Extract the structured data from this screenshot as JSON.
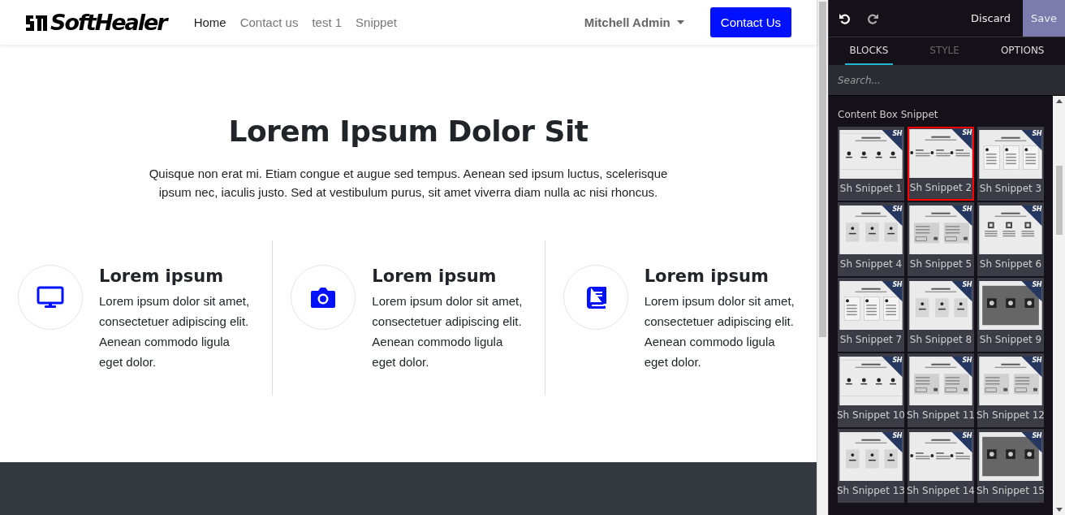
{
  "navbar": {
    "logo": "SoftHealer",
    "links": [
      {
        "label": "Home",
        "selected": true
      },
      {
        "label": "Contact us",
        "selected": false
      },
      {
        "label": "test 1",
        "selected": false
      },
      {
        "label": "Snippet",
        "selected": false
      }
    ],
    "user": "Mitchell Admin",
    "cta": "Contact Us"
  },
  "hero": {
    "title": "Lorem Ipsum Dolor Sit",
    "text": "Quisque non erat mi. Etiam congue et augue sed tempus. Aenean sed ipsum luctus, scelerisque ipsum nec, iaculis justo. Sed at vestibulum purus, sit amet viverra diam nulla ac nisi rhoncus."
  },
  "features": [
    {
      "kind": "monitor",
      "title": "Lorem ipsum",
      "text": "Lorem ipsum dolor sit amet, consectetuer adipiscing elit. Aenean commodo ligula eget dolor."
    },
    {
      "kind": "camera",
      "title": "Lorem ipsum",
      "text": "Lorem ipsum dolor sit amet, consectetuer adipiscing elit. Aenean commodo ligula eget dolor."
    },
    {
      "kind": "book",
      "title": "Lorem ipsum",
      "text": "Lorem ipsum dolor sit amet, consectetuer adipiscing elit. Aenean commodo ligula eget dolor."
    }
  ],
  "editor": {
    "discard": "Discard",
    "save": "Save",
    "tabs": [
      {
        "label": "BLOCKS",
        "selected": true,
        "disabled": false
      },
      {
        "label": "STYLE",
        "selected": false,
        "disabled": true
      },
      {
        "label": "OPTIONS",
        "selected": false,
        "disabled": false
      }
    ],
    "search": {
      "placeholder": "Search..."
    },
    "section": "Content Box Snippet",
    "blocks": [
      {
        "label": "Sh Snippet 1",
        "badge": "SH",
        "kind": "icons4",
        "selected": false
      },
      {
        "label": "Sh Snippet 2",
        "badge": "SH",
        "kind": "dots3",
        "selected": true
      },
      {
        "label": "Sh Snippet 3",
        "badge": "SH",
        "kind": "cards3",
        "selected": false
      },
      {
        "label": "Sh Snippet 4",
        "badge": "SH",
        "kind": "boxes3",
        "selected": false
      },
      {
        "label": "Sh Snippet 5",
        "badge": "SH",
        "kind": "panels2",
        "selected": false
      },
      {
        "label": "Sh Snippet 6",
        "badge": "SH",
        "kind": "framed3",
        "selected": false
      },
      {
        "label": "Sh Snippet 7",
        "badge": "SH",
        "kind": "cards3",
        "selected": false
      },
      {
        "label": "Sh Snippet 8",
        "badge": "SH",
        "kind": "boxes3",
        "selected": false
      },
      {
        "label": "Sh Snippet 9",
        "badge": "SH",
        "kind": "squares3",
        "selected": false
      },
      {
        "label": "Sh Snippet 10",
        "badge": "SH",
        "kind": "icons4",
        "selected": false
      },
      {
        "label": "Sh Snippet 11",
        "badge": "SH",
        "kind": "panels2",
        "selected": false
      },
      {
        "label": "Sh Snippet 12",
        "badge": "SH",
        "kind": "panels2",
        "selected": false
      },
      {
        "label": "Sh Snippet 13",
        "badge": "SH",
        "kind": "boxes3",
        "selected": false
      },
      {
        "label": "Sh Snippet 14",
        "badge": "SH",
        "kind": "dots3",
        "selected": false
      },
      {
        "label": "Sh Snippet 15",
        "badge": "SH",
        "kind": "squares3",
        "selected": false
      }
    ]
  }
}
